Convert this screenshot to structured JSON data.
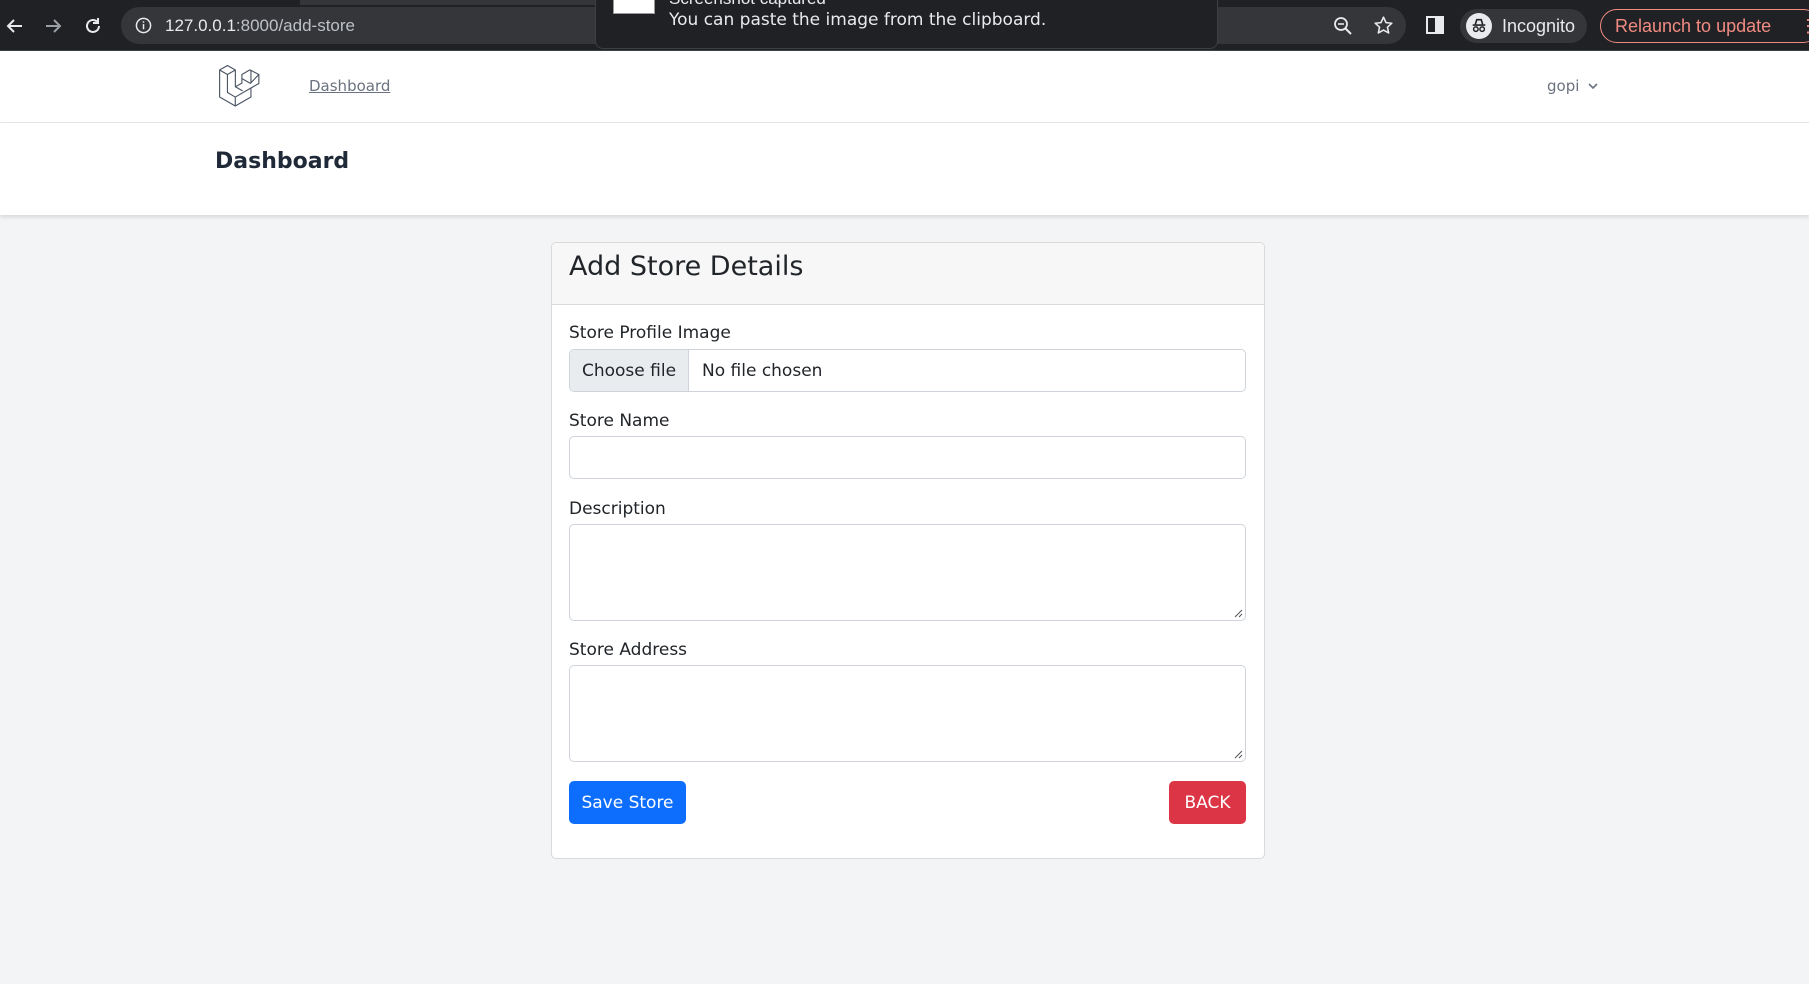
{
  "browser": {
    "url_host": "127.0.0.1",
    "url_path": ":8000/add-store",
    "incognito_label": "Incognito",
    "relaunch_label": "Relaunch to update",
    "icons": [
      "back-arrow-icon",
      "forward-arrow-icon",
      "reload-icon",
      "info-icon",
      "zoom-icon",
      "star-icon",
      "side-panel-icon",
      "incognito-icon",
      "more-vert-icon"
    ]
  },
  "toast": {
    "title": "Screenshot captured",
    "message": "You can paste the image from the clipboard."
  },
  "nav": {
    "link_label": "Dashboard",
    "user_name": "gopi",
    "logo_icon": "laravel-logo-icon"
  },
  "header": {
    "title": "Dashboard"
  },
  "form": {
    "title": "Add Store Details",
    "image_label": "Store Profile Image",
    "file_button": "Choose file",
    "file_status": "No file chosen",
    "name_label": "Store Name",
    "name_value": "",
    "description_label": "Description",
    "description_value": "",
    "address_label": "Store Address",
    "address_value": "",
    "save_label": "Save Store",
    "back_label": "BACK"
  },
  "colors": {
    "primary": "#0d6efd",
    "danger": "#dc3545",
    "page_bg": "#f3f4f6",
    "chrome_bg": "#202124"
  }
}
